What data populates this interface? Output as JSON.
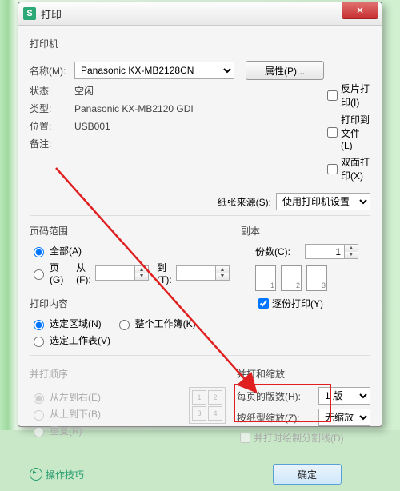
{
  "title": "打印",
  "printer": {
    "section": "打印机",
    "name_label": "名称(M):",
    "name_value": "Panasonic KX-MB2128CN",
    "properties_btn": "属性(P)...",
    "status_label": "状态:",
    "status_value": "空闲",
    "type_label": "类型:",
    "type_value": "Panasonic KX-MB2120 GDI",
    "where_label": "位置:",
    "where_value": "USB001",
    "comment_label": "备注:",
    "comment_value": "",
    "reverse": "反片打印(I)",
    "tofile": "打印到文件(L)",
    "duplex": "双面打印(X)",
    "source_label": "纸张来源(S):",
    "source_value": "使用打印机设置"
  },
  "range": {
    "section": "页码范围",
    "all": "全部(A)",
    "pages": "页(G)",
    "from": "从(F):",
    "to": "到(T):"
  },
  "copies": {
    "section": "副本",
    "count_label": "份数(C):",
    "count_value": "1",
    "collate": "逐份打印(Y)"
  },
  "content": {
    "section": "打印内容",
    "selection": "选定区域(N)",
    "workbook": "整个工作簿(K)",
    "sheets": "选定工作表(V)"
  },
  "order": {
    "section": "并打顺序",
    "lr": "从左到右(E)",
    "tb": "从上到下(B)",
    "repeat": "重复(R)"
  },
  "scale": {
    "section": "并打和缩放",
    "per_page_label": "每页的版数(H):",
    "per_page_value": "1 版",
    "scale_label": "按纸型缩放(Z):",
    "scale_value": "无缩放",
    "draw_lines": "并打时绘制分割线(D)"
  },
  "footer": {
    "tips": "操作技巧",
    "ok": "确定"
  }
}
